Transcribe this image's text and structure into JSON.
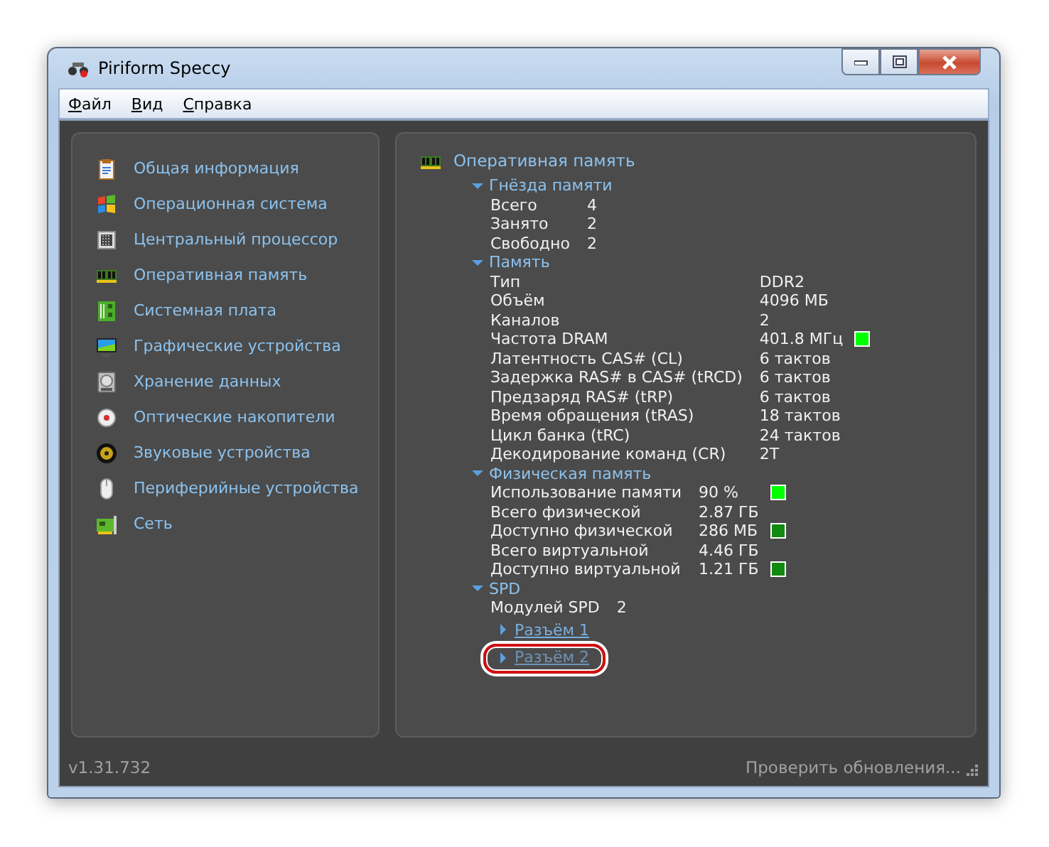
{
  "window": {
    "title": "Piriform Speccy"
  },
  "menu": [
    "Файл",
    "Вид",
    "Справка"
  ],
  "sidebar": {
    "items": [
      {
        "label": "Общая информация",
        "selected": false
      },
      {
        "label": "Операционная система",
        "selected": false
      },
      {
        "label": "Центральный процессор",
        "selected": false
      },
      {
        "label": "Оперативная память",
        "selected": false
      },
      {
        "label": "Системная плата",
        "selected": false
      },
      {
        "label": "Графические устройства",
        "selected": false
      },
      {
        "label": "Хранение данных",
        "selected": false
      },
      {
        "label": "Оптические накопители",
        "selected": false
      },
      {
        "label": "Звуковые устройства",
        "selected": false
      },
      {
        "label": "Периферийные устройства",
        "selected": false
      },
      {
        "label": "Сеть",
        "selected": false
      }
    ]
  },
  "details": {
    "title": "Оперативная память",
    "sections": [
      {
        "title": "Гнёзда памяти",
        "expanded": true,
        "rows": [
          {
            "label": "Всего",
            "value": "4"
          },
          {
            "label": "Занято",
            "value": "2"
          },
          {
            "label": "Свободно",
            "value": "2"
          }
        ]
      },
      {
        "title": "Память",
        "expanded": true,
        "rows": [
          {
            "label": "Тип",
            "value": "DDR2"
          },
          {
            "label": "Объём",
            "value": "4096 МБ"
          },
          {
            "label": "Каналов",
            "value": "2"
          },
          {
            "label": "Частота DRAM",
            "value": "401.8 МГц",
            "color": "#00ff00"
          },
          {
            "label": "Латентность CAS# (CL)",
            "value": "6 тактов"
          },
          {
            "label": "Задержка RAS# в CAS# (tRCD)",
            "value": "6 тактов"
          },
          {
            "label": "Предзаряд RAS# (tRP)",
            "value": "6 тактов"
          },
          {
            "label": "Время обращения (tRAS)",
            "value": "18 тактов"
          },
          {
            "label": "Цикл банка (tRC)",
            "value": "24 тактов"
          },
          {
            "label": "Декодирование команд (CR)",
            "value": "2T"
          }
        ]
      },
      {
        "title": "Физическая память",
        "expanded": true,
        "rows": [
          {
            "label": "Использование памяти",
            "value": "90 %",
            "color": "#00ff00"
          },
          {
            "label": "Всего физической",
            "value": "2.87 ГБ"
          },
          {
            "label": "Доступно физической",
            "value": "286 МБ",
            "color": "#108a10"
          },
          {
            "label": "Всего виртуальной",
            "value": "4.46 ГБ"
          },
          {
            "label": "Доступно виртуальной",
            "value": "1.21 ГБ",
            "color": "#108a10"
          }
        ]
      },
      {
        "title": "SPD",
        "expanded": true,
        "rows": [
          {
            "label": "Модулей SPD",
            "value": "2"
          }
        ],
        "slots": [
          {
            "label": "Разъём 1",
            "expanded": false,
            "highlighted": false
          },
          {
            "label": "Разъём 2",
            "expanded": false,
            "highlighted": true
          }
        ]
      }
    ]
  },
  "status_bar": {
    "version": "v1.31.732",
    "update_link": "Проверить обновления..."
  }
}
